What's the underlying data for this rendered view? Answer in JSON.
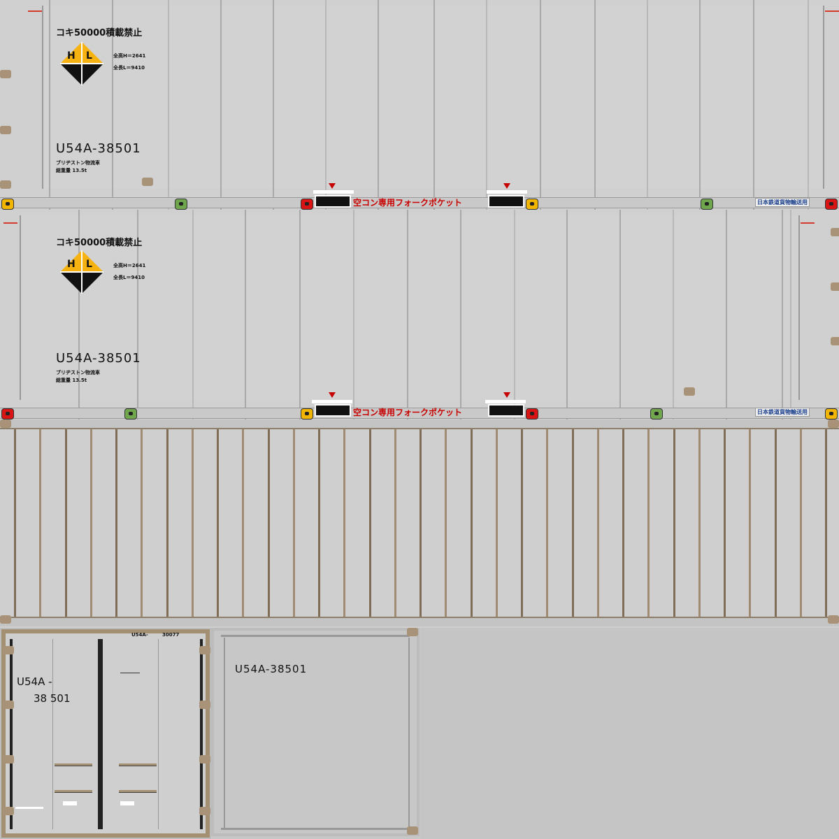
{
  "side_panel": {
    "warning_text": "コキ50000積載禁止",
    "hl_left": "H",
    "hl_right": "L",
    "height_text": "全高H＝2641",
    "length_text": "全長L＝9410",
    "container_id": "U54A-38501",
    "owner_text": "ブリヂストン物流車",
    "gross_weight_text": "総重量 13.5t",
    "fork_pocket_text": "空コン専用フォークポケット",
    "jr_text": "日本鉄道貨物輸送用"
  },
  "door_end": {
    "id_line1": "U54A -",
    "id_line2": "38 501",
    "small_id_a": "U54A-",
    "small_id_b": "30077"
  },
  "front_end": {
    "container_id": "U54A-38501"
  },
  "colors": {
    "hl_yellow": "#f5b210",
    "fork_red": "#c80000",
    "jr_blue": "#1a3f8c",
    "frame_tan": "#a38f72"
  }
}
